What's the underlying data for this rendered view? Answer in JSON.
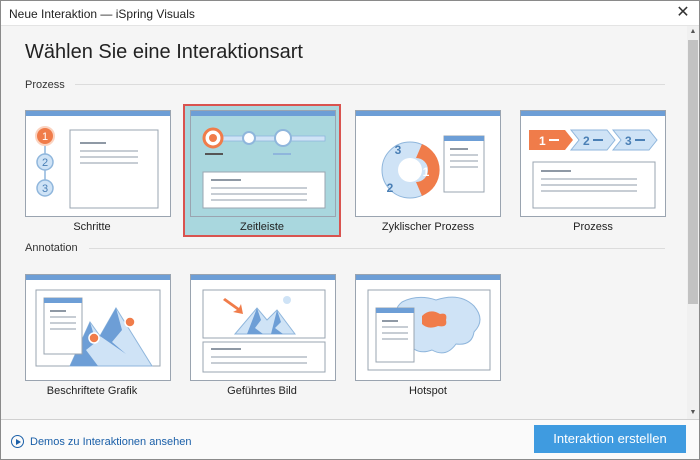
{
  "window": {
    "title": "Neue Interaktion — iSpring Visuals",
    "close_glyph": "✕"
  },
  "main": {
    "heading": "Wählen Sie eine Interaktionsart",
    "sections": [
      {
        "label": "Prozess",
        "items": [
          {
            "label": "Schritte",
            "selected": false
          },
          {
            "label": "Zeitleiste",
            "selected": true
          },
          {
            "label": "Zyklischer Prozess",
            "selected": false
          },
          {
            "label": "Prozess",
            "selected": false
          }
        ]
      },
      {
        "label": "Annotation",
        "items": [
          {
            "label": "Beschriftete Grafik",
            "selected": false
          },
          {
            "label": "Geführtes Bild",
            "selected": false
          },
          {
            "label": "Hotspot",
            "selected": false
          }
        ]
      }
    ]
  },
  "thumbnails": {
    "schritte": [
      "1",
      "2",
      "3"
    ],
    "zyklisch": [
      "3",
      "2",
      "1"
    ],
    "prozess": [
      "1",
      "2",
      "3"
    ]
  },
  "footer": {
    "demo_link": "Demos zu Interaktionen ansehen",
    "create_button": "Interaktion erstellen"
  },
  "colors": {
    "accent": "#3f9be0",
    "selected_bg": "#a9d7de",
    "selected_border": "#d9534f",
    "orange": "#f07c4a",
    "light_blue": "#cfe3f6",
    "header_blue": "#6d9ed6"
  }
}
